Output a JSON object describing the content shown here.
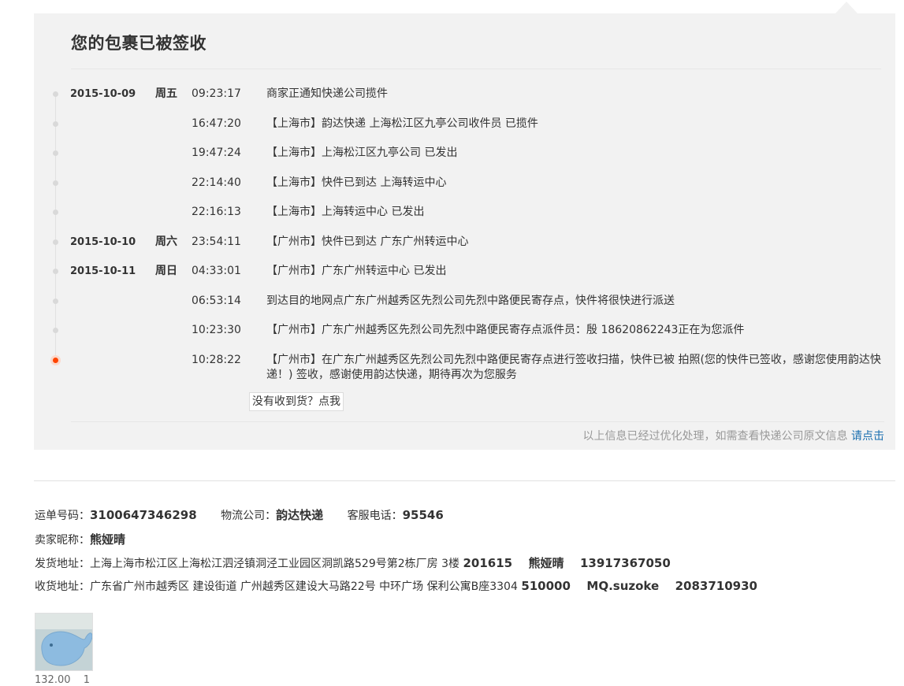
{
  "title": "您的包裹已被签收",
  "events": [
    {
      "date": "2015-10-09",
      "weekday": "周五",
      "time": "09:23:17",
      "msg": "商家正通知快递公司揽件"
    },
    {
      "date": "",
      "weekday": "",
      "time": "16:47:20",
      "msg": "【上海市】韵达快递 上海松江区九亭公司收件员 已揽件"
    },
    {
      "date": "",
      "weekday": "",
      "time": "19:47:24",
      "msg": "【上海市】上海松江区九亭公司 已发出"
    },
    {
      "date": "",
      "weekday": "",
      "time": "22:14:40",
      "msg": "【上海市】快件已到达 上海转运中心"
    },
    {
      "date": "",
      "weekday": "",
      "time": "22:16:13",
      "msg": "【上海市】上海转运中心 已发出"
    },
    {
      "date": "2015-10-10",
      "weekday": "周六",
      "time": "23:54:11",
      "msg": "【广州市】快件已到达 广东广州转运中心"
    },
    {
      "date": "2015-10-11",
      "weekday": "周日",
      "time": "04:33:01",
      "msg": "【广州市】广东广州转运中心 已发出"
    },
    {
      "date": "",
      "weekday": "",
      "time": "06:53:14",
      "msg": "到达目的地网点广东广州越秀区先烈公司先烈中路便民寄存点，快件将很快进行派送"
    },
    {
      "date": "",
      "weekday": "",
      "time": "10:23:30",
      "msg": "【广州市】广东广州越秀区先烈公司先烈中路便民寄存点派件员：殷 18620862243正在为您派件"
    },
    {
      "date": "",
      "weekday": "",
      "time": "10:28:22",
      "msg": "【广州市】在广东广州越秀区先烈公司先烈中路便民寄存点进行签收扫描，快件已被 拍照(您的快件已签收，感谢您使用韵达快递！) 签收，感谢使用韵达快递，期待再次为您服务"
    }
  ],
  "no_receive_button": "没有收到货？点我",
  "note_text": "以上信息已经过优化处理，如需查看快递公司原文信息",
  "note_link": "请点击",
  "waybill_label": "运单号码：",
  "waybill_value": "3100647346298",
  "company_label": "物流公司：",
  "company_value": "韵达快递",
  "phone_label": "客服电话：",
  "phone_value": "95546",
  "seller_label": "卖家昵称：",
  "seller_value": "熊娅晴",
  "ship_label": "发货地址：",
  "ship_address": "上海上海市松江区上海松江泗泾镇洞泾工业园区洞凯路529号第2栋厂房 3楼",
  "ship_zip": "201615",
  "ship_name": "熊娅晴",
  "ship_phone": "13917367050",
  "recv_label": "收货地址：",
  "recv_address": "广东省广州市越秀区 建设街道 广州越秀区建设大马路22号 中环广场 保利公寓B座3304",
  "recv_zip": "510000",
  "recv_name": "MQ.suzoke",
  "recv_phone": "2083710930",
  "product_price": "132.00",
  "product_qty": "1",
  "colors": {
    "active_dot": "#ff4400",
    "link": "#1a6fb0",
    "panel_bg": "#f2f2f2"
  }
}
